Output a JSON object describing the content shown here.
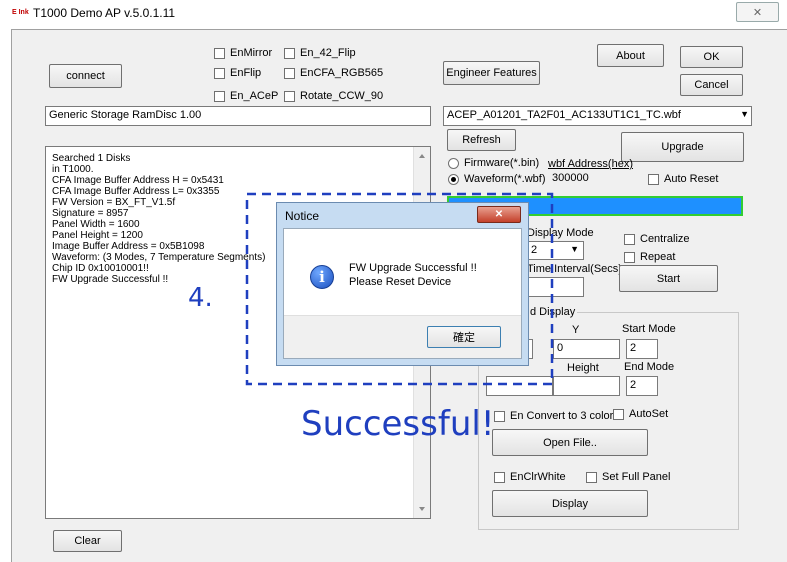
{
  "window": {
    "logo": "E Ink",
    "title": "T1000 Demo AP v.5.0.1.11",
    "close_glyph": "✕"
  },
  "toolbar": {
    "connect": "connect",
    "about": "About",
    "ok": "OK",
    "cancel": "Cancel",
    "engineer": "Engineer Features",
    "checks": [
      "EnMirror",
      "En_42_Flip",
      "EnFlip",
      "EnCFA_RGB565",
      "En_ACeP",
      "Rotate_CCW_90"
    ]
  },
  "device_field": "Generic Storage RamDisc 1.00",
  "file_select": {
    "value": "ACEP_A01201_TA2F01_AC133UT1C1_TC.wbf",
    "arrow": "▼"
  },
  "refresh": "Refresh",
  "upgrade": "Upgrade",
  "firmware_radio": "Firmware(*.bin)",
  "waveform_radio": "Waveform(*.wbf)",
  "wbf_address": {
    "label": "wbf Address(hex)",
    "value": "300000"
  },
  "auto_reset": "Auto Reset",
  "progress": {
    "fraction": 1.0,
    "color": "#1e90ff"
  },
  "display_mode": {
    "label": "Display Mode",
    "value": "2",
    "arrow": "▼"
  },
  "centralize": "Centralize",
  "repeat": "Repeat",
  "time_interval": "Time Interval(Secs)",
  "start": "Start",
  "group_display": {
    "title": "d Display",
    "y_label": "Y",
    "y_value": "0",
    "start_mode_label": "Start Mode",
    "start_mode_value": "2",
    "height_label": "Height",
    "end_mode_label": "End Mode",
    "end_mode_value": "2",
    "convert3": "En Convert to 3 color",
    "autoset": "AutoSet",
    "open_file": "Open File..",
    "enclrwhite": "EnClrWhite",
    "fullpanel": "Set Full Panel",
    "display": "Display"
  },
  "log": {
    "lines": [
      "Searched 1 Disks",
      "in T1000.",
      "CFA Image Buffer Address H = 0x5431",
      "CFA Image Buffer Address L= 0x3355",
      "FW Version = BX_FT_V1.5f",
      "Signature = 8957",
      "Panel Width = 1600",
      "Panel Height = 1200",
      "Image Buffer Address = 0x5B1098",
      "Waveform: (3 Modes, 7 Temperature Segments)",
      "Chip ID 0x10010001!!",
      "FW Upgrade Successful !!"
    ]
  },
  "clear": "Clear",
  "dialog": {
    "title": "Notice",
    "close": "✕",
    "icon_glyph": "i",
    "line1": "FW Upgrade Successful !!",
    "line2": "Please Reset Device",
    "confirm": "確定"
  },
  "annotation": {
    "step": "4.",
    "message": "Successful!",
    "color": "#1f3fbf"
  }
}
